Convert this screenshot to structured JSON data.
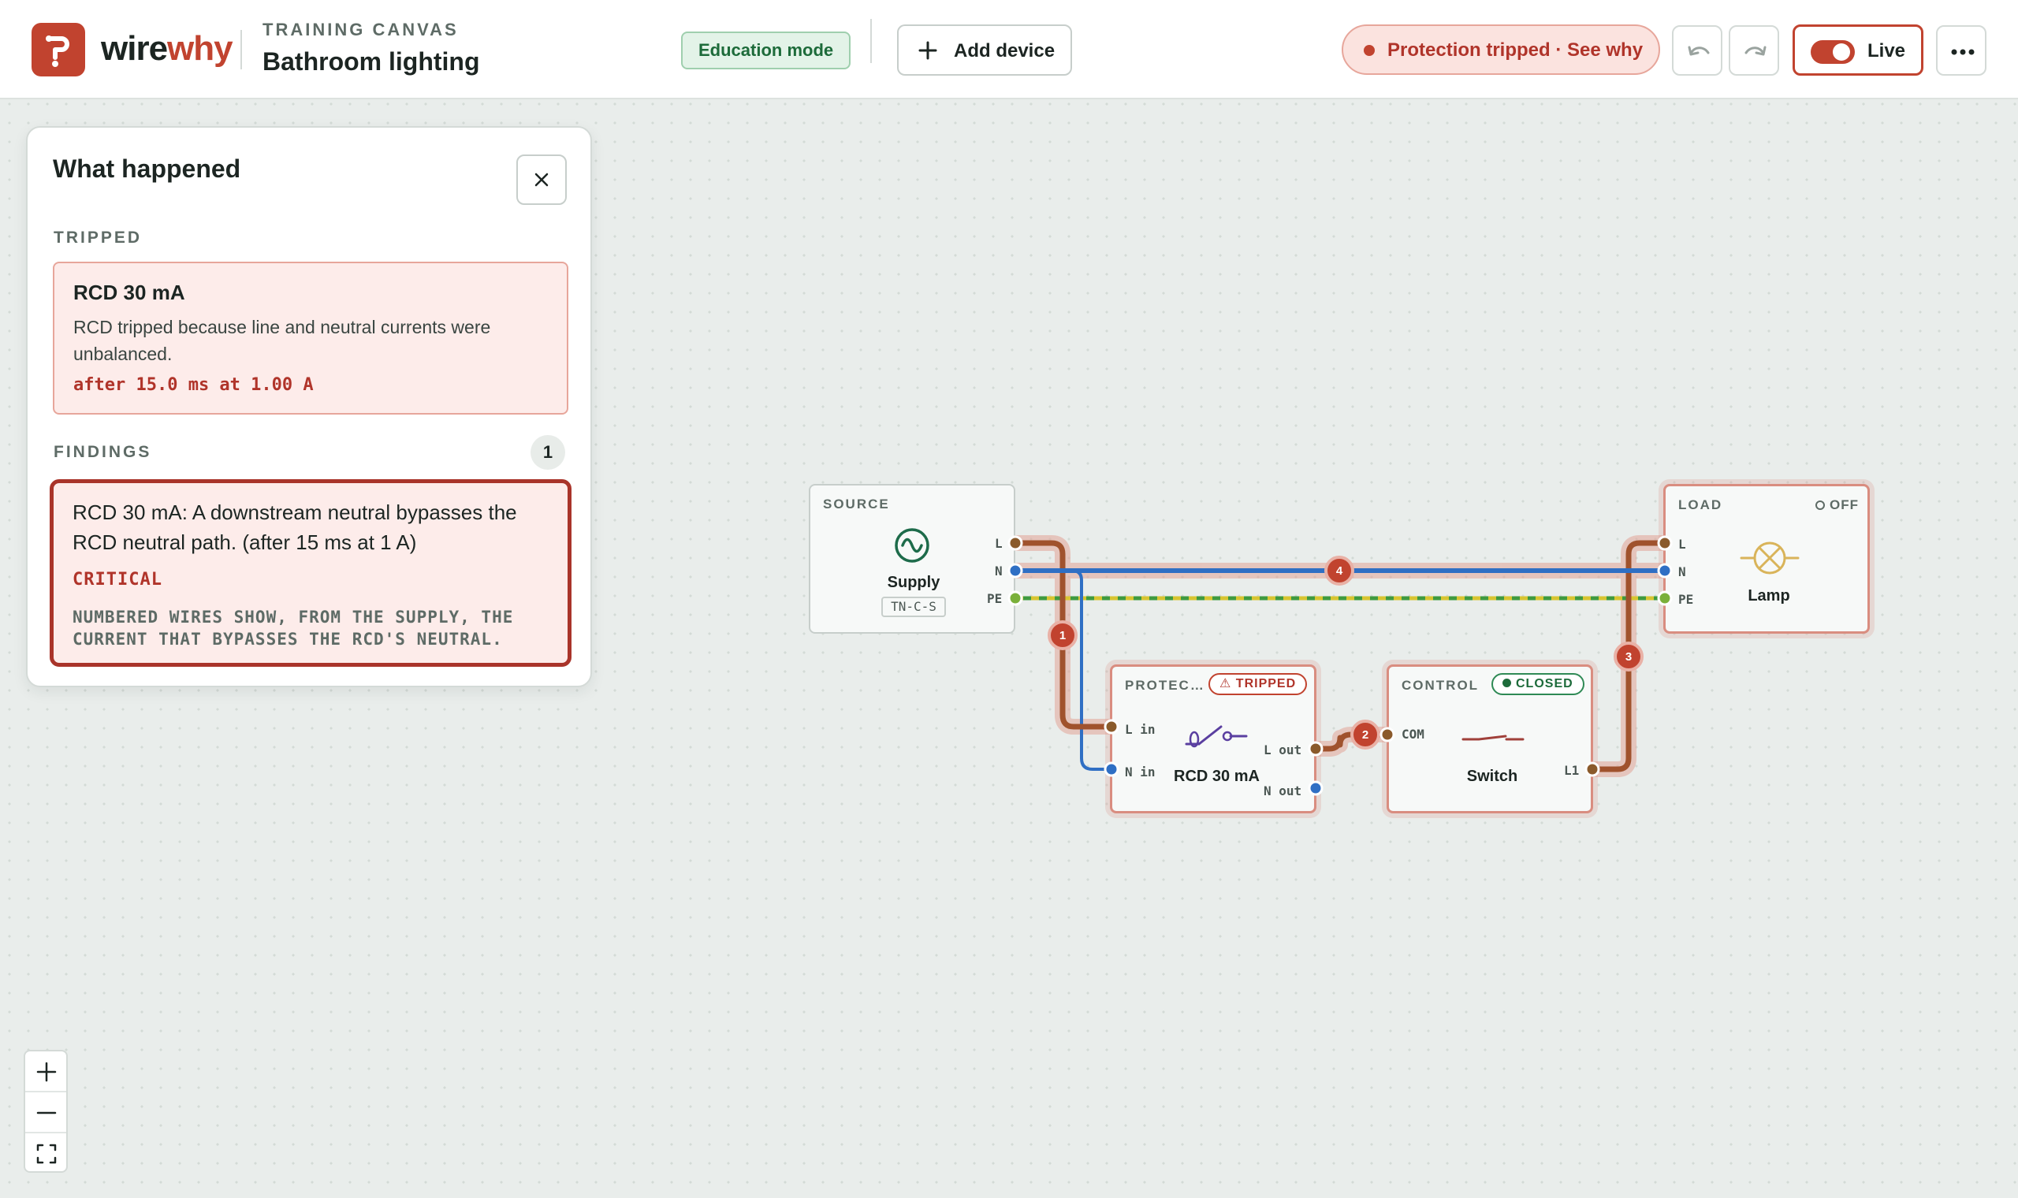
{
  "app": {
    "brand_part1": "wire",
    "brand_part2": "why",
    "crumb": "TRAINING CANVAS",
    "title": "Bathroom lighting",
    "mode_badge": "Education mode",
    "add_device_label": "Add device",
    "protection_status": "Protection tripped · See why",
    "live_label": "Live",
    "live_on": true
  },
  "panel": {
    "title": "What happened",
    "tripped_heading": "TRIPPED",
    "tripped": {
      "device": "RCD 30 mA",
      "description": "RCD tripped because line and neutral currents were unbalanced.",
      "metric": "after 15.0 ms at 1.00 A"
    },
    "findings_heading": "FINDINGS",
    "findings_count": "1",
    "finding": {
      "text": "RCD 30 mA: A downstream neutral bypasses the RCD neutral path. (after 15 ms at 1 A)",
      "severity": "CRITICAL",
      "note": "NUMBERED WIRES SHOW, FROM THE SUPPLY, THE CURRENT THAT BYPASSES THE RCD'S NEUTRAL."
    }
  },
  "devices": {
    "source": {
      "category": "SOURCE",
      "name": "Supply",
      "system": "TN-C-S",
      "ports": [
        "L",
        "N",
        "PE"
      ]
    },
    "protection": {
      "category": "PROTEC…",
      "status": "TRIPPED",
      "name": "RCD 30 mA",
      "port_l_in": "L in",
      "port_n_in": "N in",
      "port_l_out": "L out",
      "port_n_out": "N out"
    },
    "control": {
      "category": "CONTROL",
      "status": "CLOSED",
      "name": "Switch",
      "port_com": "COM",
      "port_l1": "L1"
    },
    "load": {
      "category": "LOAD",
      "status": "OFF",
      "name": "Lamp",
      "ports": [
        "L",
        "N",
        "PE"
      ]
    }
  },
  "wire_markers": [
    "1",
    "2",
    "3",
    "4"
  ],
  "colors": {
    "accent": "#c1432f",
    "line_wire": "#a0522d",
    "neutral_wire": "#2f6fc4",
    "earth_wire_green": "#3f9a3f",
    "earth_wire_yellow": "#d8c531",
    "ok_green": "#1d6b3a"
  },
  "icons": [
    "logo-icon",
    "plus-icon",
    "undo-icon",
    "redo-icon",
    "more-icon",
    "close-icon",
    "ac-source-icon",
    "rcd-icon",
    "switch-icon",
    "lamp-icon",
    "zoom-in-icon",
    "zoom-out-icon",
    "fit-screen-icon"
  ]
}
